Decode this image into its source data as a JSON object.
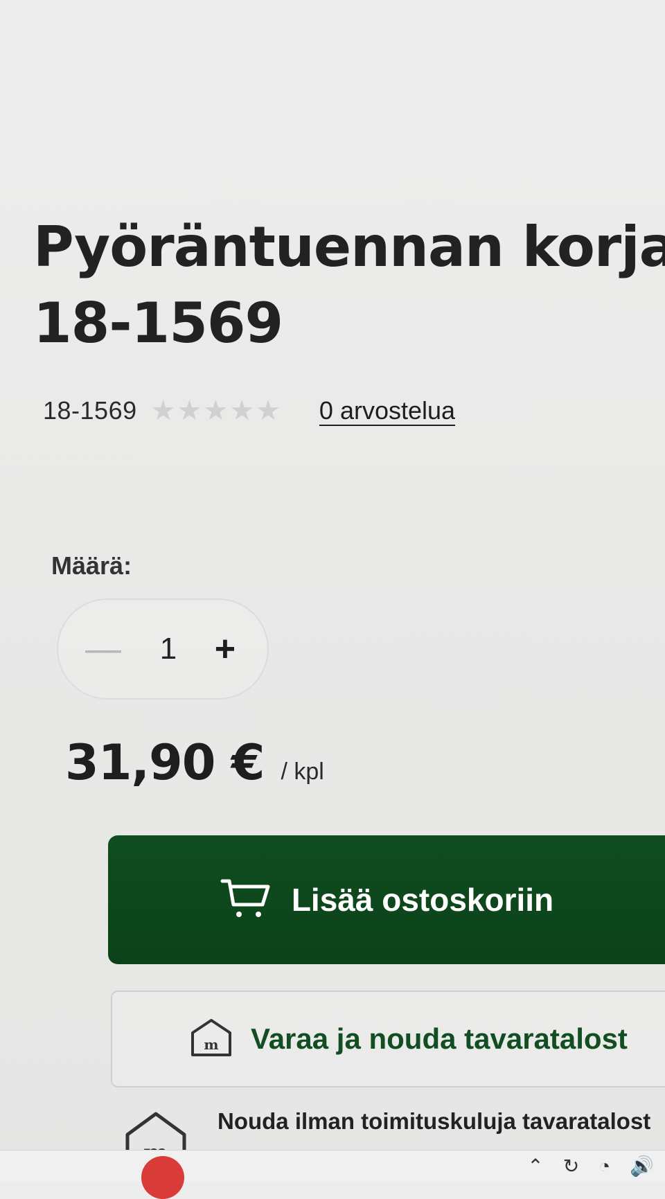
{
  "product": {
    "title_line1": "Pyöräntuennan korjaus",
    "title_line2": "18-1569",
    "sku": "18-1569",
    "rating_stars": 0,
    "reviews_label": "0 arvostelua"
  },
  "quantity": {
    "label": "Määrä:",
    "value": "1"
  },
  "pricing": {
    "price": "31,90 €",
    "unit": "/ kpl"
  },
  "actions": {
    "add_to_cart": "Lisää ostoskoriin",
    "reserve_pickup": "Varaa ja nouda tavaratalost",
    "free_pickup": "Nouda ilman toimituskuluja tavaratalost"
  },
  "icons": {
    "cart": "cart-icon",
    "store": "store-icon",
    "store_outline": "store-outline-icon"
  },
  "colors": {
    "brand_green": "#0f4d1f",
    "link_text": "#134d22",
    "star_empty": "#d0d0d0",
    "taskbar_pin": "#d93b38"
  }
}
